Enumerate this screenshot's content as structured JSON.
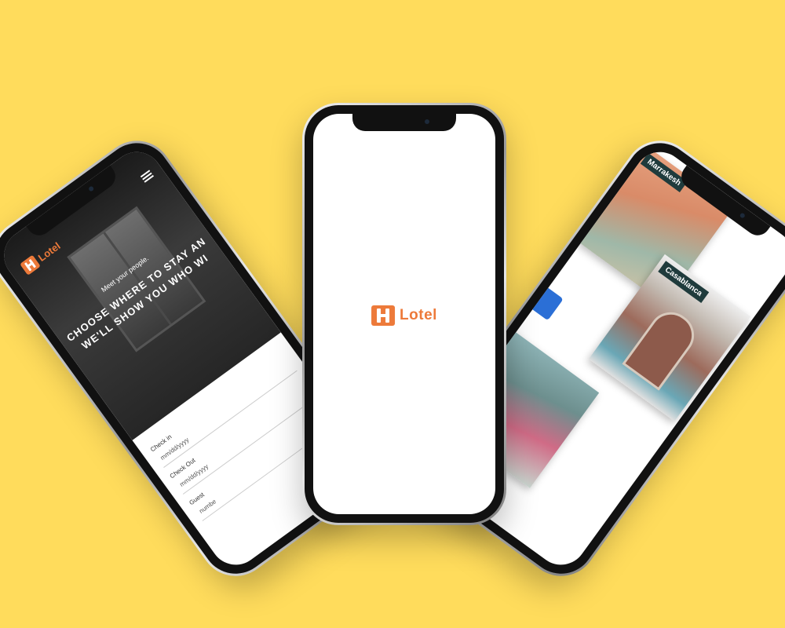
{
  "left_screen": {
    "brand": "Lotel",
    "tagline": "Meet your people.",
    "headline_line1": "CHOOSE WHERE TO STAY AN",
    "headline_line2": "WE'LL SHOW YOU WHO WI",
    "form": {
      "checkin_label": "Check in",
      "checkin_value": "mm/dd/yyyy",
      "checkout_label": "Check Out",
      "checkout_value": "mm/dd/yyyy",
      "guest_label": "Guest",
      "guest_value": "numbe"
    }
  },
  "center_screen": {
    "brand": "Lotel"
  },
  "right_screen": {
    "cards": [
      "Marrakesh",
      "Casablanca"
    ]
  },
  "colors": {
    "background": "#FFDC5C",
    "brand": "#ED7A3A"
  }
}
